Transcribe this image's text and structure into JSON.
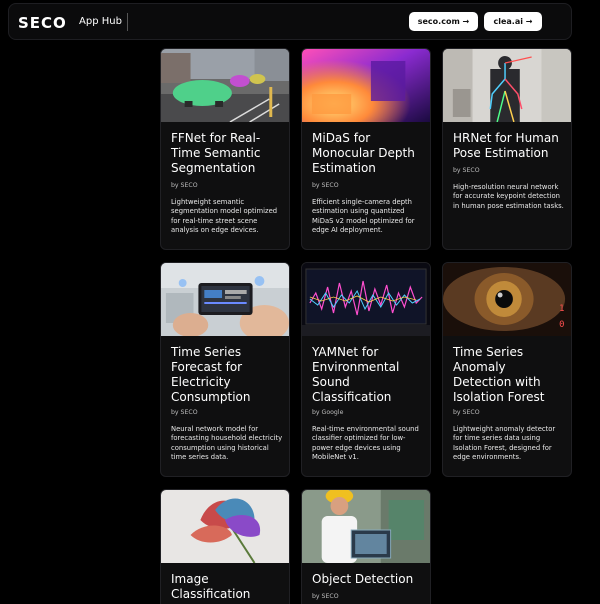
{
  "header": {
    "logo": "SECO",
    "app_name": "App Hub",
    "links": [
      {
        "label": "seco.com →"
      },
      {
        "label": "clea.ai →"
      }
    ]
  },
  "cards": [
    {
      "title": "FFNet for Real-Time Semantic Segmentation",
      "by": "by SECO",
      "description": "Lightweight semantic segmentation model optimized for real-time street scene analysis on edge devices."
    },
    {
      "title": "MiDaS for Monocular Depth Estimation",
      "by": "by SECO",
      "description": "Efficient single-camera depth estimation using quantized MiDaS v2 model optimized for edge AI deployment."
    },
    {
      "title": "HRNet for Human Pose Estimation",
      "by": "by SECO",
      "description": "High-resolution neural network for accurate keypoint detection in human pose estimation tasks."
    },
    {
      "title": "Time Series Forecast for Electricity Consumption",
      "by": "by SECO",
      "description": "Neural network model for forecasting household electricity consumption using historical time series data."
    },
    {
      "title": "YAMNet for Environmental Sound Classification",
      "by": "by Google",
      "description": "Real-time environmental sound classifier optimized for low-power edge devices using MobileNet v1."
    },
    {
      "title": "Time Series Anomaly Detection with Isolation Forest",
      "by": "by SECO",
      "description": "Lightweight anomaly detector for time series data using Isolation Forest, designed for edge environments."
    },
    {
      "title": "Image Classification",
      "by": "",
      "description": ""
    },
    {
      "title": "Object Detection",
      "by": "by SECO",
      "description": ""
    }
  ],
  "colors": {
    "background": "#000000",
    "card": "#0f0f10",
    "header": "#0b0b0c",
    "button": "#ffffff"
  }
}
